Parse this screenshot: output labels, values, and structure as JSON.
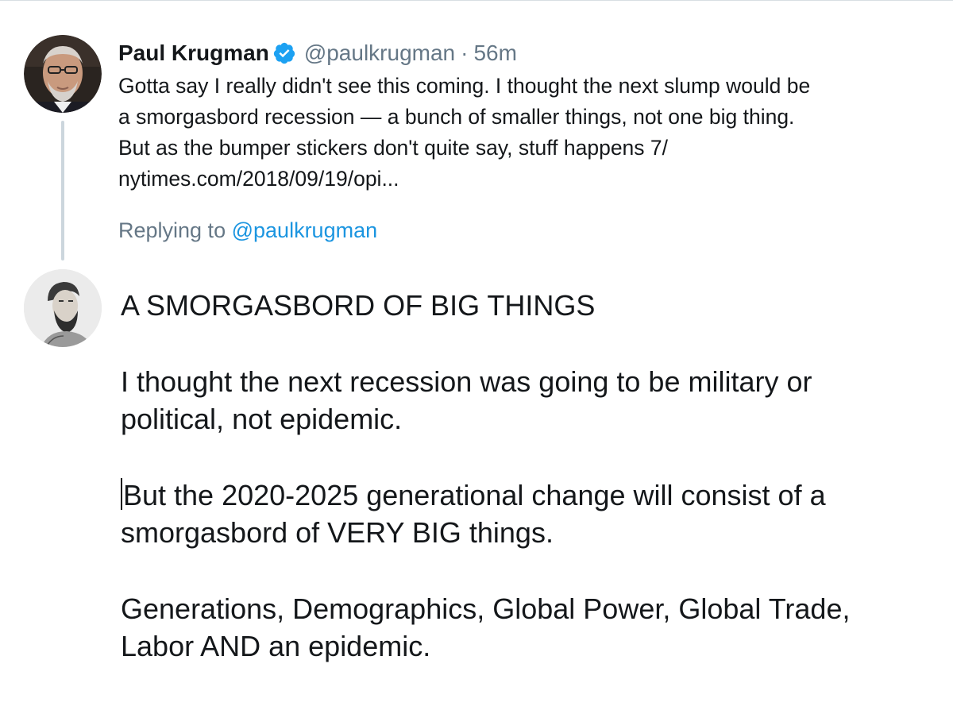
{
  "tweet": {
    "author_name": "Paul Krugman",
    "handle": "@paulkrugman",
    "separator": "·",
    "time": "56m",
    "verified_icon": "verified-badge-icon",
    "text_lines": [
      "Gotta say I really didn't see this coming. I thought the next slump would be",
      "a smorgasbord recession — a bunch of smaller things, not one big thing.",
      "But as the bumper stickers don't quite say, stuff happens 7/",
      "nytimes.com/2018/09/19/opi..."
    ]
  },
  "reply": {
    "replying_prefix": "Replying to",
    "replying_mention": "@paulkrugman",
    "compose_paragraphs": [
      [
        "A SMORGASBORD OF BIG THINGS"
      ],
      [
        "I thought  the next recession was going to be military or",
        "political, not epidemic."
      ],
      [
        "But the 2020-2025 generational change will consist of a",
        "smorgasbord of VERY BIG things."
      ],
      [
        "Generations, Demographics, Global Power, Global Trade,",
        "Labor AND an epidemic."
      ]
    ]
  },
  "colors": {
    "text_primary": "#14171a",
    "text_secondary": "#657786",
    "link": "#1b95e0",
    "verified": "#1da1f2",
    "thread_line": "#ccd6dd"
  }
}
